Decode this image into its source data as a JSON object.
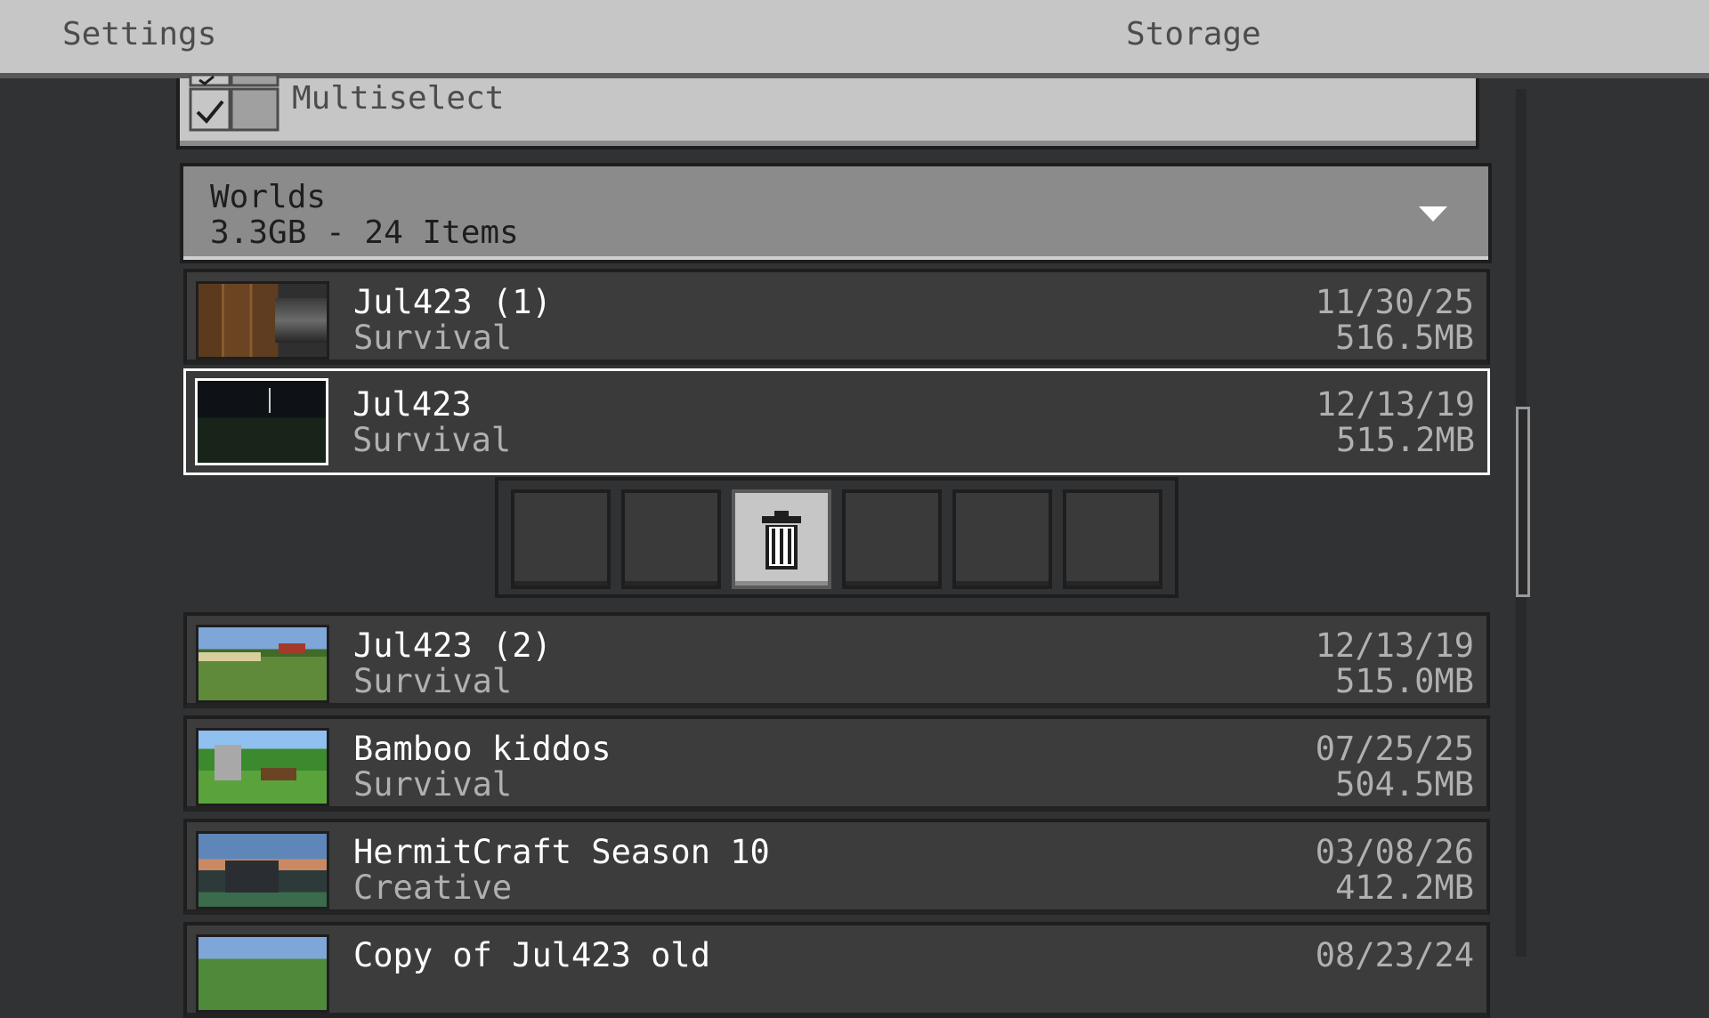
{
  "topbar": {
    "settings_tab": "Settings",
    "storage_tab": "Storage"
  },
  "multiselect": {
    "label": "Multiselect",
    "icon": "multiselect-checkbox-icon"
  },
  "worlds_group": {
    "title": "Worlds",
    "summary": "3.3GB - 24 Items",
    "expanded": true
  },
  "worlds": [
    {
      "name": "Jul423 (1)",
      "mode": "Survival",
      "date": "11/30/25",
      "size": "516.5MB",
      "selected": false
    },
    {
      "name": "Jul423",
      "mode": "Survival",
      "date": "12/13/19",
      "size": "515.2MB",
      "selected": true
    },
    {
      "name": "Jul423 (2)",
      "mode": "Survival",
      "date": "12/13/19",
      "size": "515.0MB",
      "selected": false
    },
    {
      "name": "Bamboo kiddos",
      "mode": "Survival",
      "date": "07/25/25",
      "size": "504.5MB",
      "selected": false
    },
    {
      "name": "HermitCraft Season 10",
      "mode": "Creative",
      "date": "03/08/26",
      "size": "412.2MB",
      "selected": false
    },
    {
      "name": "Copy of Jul423 old",
      "mode": "",
      "date": "08/23/24",
      "size": "",
      "selected": false
    }
  ],
  "action_bar": {
    "slots": [
      "empty",
      "empty",
      "trash-icon",
      "empty",
      "empty",
      "empty"
    ],
    "active_slot": 2
  },
  "colors": {
    "background": "#313233",
    "panel": "#c6c6c6",
    "row": "#3c3c3d",
    "selected_border": "#ffffff"
  }
}
